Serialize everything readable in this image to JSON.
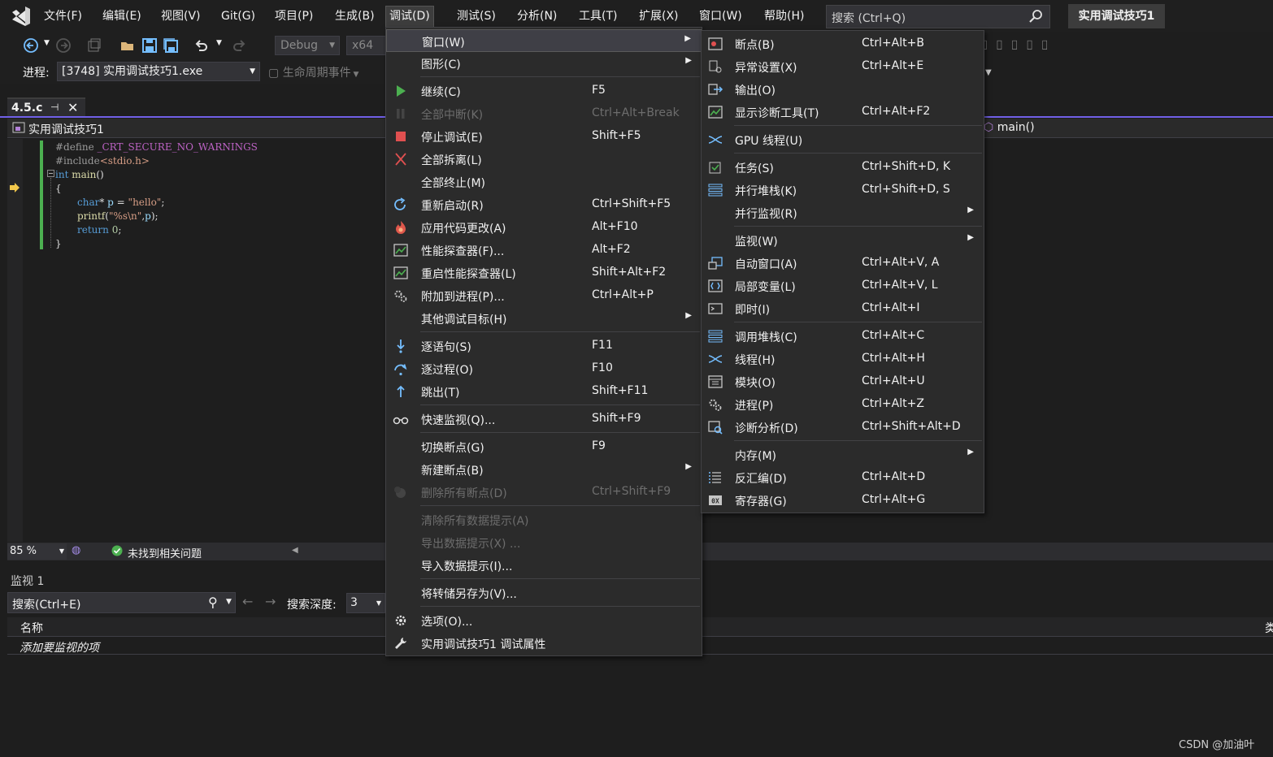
{
  "menubar": {
    "items": [
      "文件(F)",
      "编辑(E)",
      "视图(V)",
      "Git(G)",
      "项目(P)",
      "生成(B)",
      "调试(D)",
      "测试(S)",
      "分析(N)",
      "工具(T)",
      "扩展(X)",
      "窗口(W)",
      "帮助(H)"
    ],
    "active_index": 6,
    "search_placeholder": "搜索 (Ctrl+Q)",
    "solution_name": "实用调试技巧1"
  },
  "toolbar": {
    "config": "Debug",
    "platform": "x64",
    "process_label": "进程:",
    "process_value": "[3748] 实用调试技巧1.exe",
    "lifecycle_label": "生命周期事件"
  },
  "editor": {
    "tab_name": "4.5.c",
    "project_name": "实用调试技巧1",
    "function_name": "main()",
    "zoom": "85 %",
    "status": "未找到相关问题",
    "accent_color": "#7160e8",
    "change_bar_color": "#4cb050"
  },
  "watch": {
    "title": "监视 1",
    "search_placeholder": "搜索(Ctrl+E)",
    "depth_label": "搜索深度:",
    "depth_value": "3",
    "col_name": "名称",
    "col_type_partial": "类",
    "add_item": "添加要监视的项"
  },
  "debug_menu": [
    {
      "label": "窗口(W)",
      "shortcut": "",
      "submenu": true,
      "icon": "",
      "highlighted": true,
      "disabled": false
    },
    {
      "label": "图形(C)",
      "shortcut": "",
      "submenu": true,
      "icon": "",
      "disabled": false
    },
    {
      "sep": true
    },
    {
      "label": "继续(C)",
      "shortcut": "F5",
      "icon": "play-icon",
      "disabled": false
    },
    {
      "label": "全部中断(K)",
      "shortcut": "Ctrl+Alt+Break",
      "icon": "pause-icon",
      "disabled": true
    },
    {
      "label": "停止调试(E)",
      "shortcut": "Shift+F5",
      "icon": "stop-icon",
      "disabled": false
    },
    {
      "label": "全部拆离(L)",
      "shortcut": "",
      "icon": "detach-icon",
      "disabled": false
    },
    {
      "label": "全部终止(M)",
      "shortcut": "",
      "icon": "",
      "disabled": false
    },
    {
      "label": "重新启动(R)",
      "shortcut": "Ctrl+Shift+F5",
      "icon": "restart-icon",
      "disabled": false
    },
    {
      "label": "应用代码更改(A)",
      "shortcut": "Alt+F10",
      "icon": "hot-reload-icon",
      "disabled": false
    },
    {
      "label": "性能探查器(F)...",
      "shortcut": "Alt+F2",
      "icon": "profiler-icon",
      "disabled": false
    },
    {
      "label": "重启性能探查器(L)",
      "shortcut": "Shift+Alt+F2",
      "icon": "profiler-restart-icon",
      "disabled": false
    },
    {
      "label": "附加到进程(P)...",
      "shortcut": "Ctrl+Alt+P",
      "icon": "attach-icon",
      "disabled": false
    },
    {
      "label": "其他调试目标(H)",
      "shortcut": "",
      "submenu": true,
      "icon": "",
      "disabled": false
    },
    {
      "sep": true
    },
    {
      "label": "逐语句(S)",
      "shortcut": "F11",
      "icon": "step-into-icon",
      "disabled": false
    },
    {
      "label": "逐过程(O)",
      "shortcut": "F10",
      "icon": "step-over-icon",
      "disabled": false
    },
    {
      "label": "跳出(T)",
      "shortcut": "Shift+F11",
      "icon": "step-out-icon",
      "disabled": false
    },
    {
      "sep": true
    },
    {
      "label": "快速监视(Q)...",
      "shortcut": "Shift+F9",
      "icon": "quickwatch-icon",
      "disabled": false
    },
    {
      "sep": true
    },
    {
      "label": "切换断点(G)",
      "shortcut": "F9",
      "icon": "",
      "disabled": false
    },
    {
      "label": "新建断点(B)",
      "shortcut": "",
      "submenu": true,
      "icon": "",
      "disabled": false
    },
    {
      "label": "删除所有断点(D)",
      "shortcut": "Ctrl+Shift+F9",
      "icon": "delete-breakpoints-icon",
      "disabled": true
    },
    {
      "sep": true
    },
    {
      "label": "清除所有数据提示(A)",
      "shortcut": "",
      "icon": "",
      "disabled": true
    },
    {
      "label": "导出数据提示(X) ...",
      "shortcut": "",
      "icon": "",
      "disabled": true
    },
    {
      "label": "导入数据提示(I)...",
      "shortcut": "",
      "icon": "",
      "disabled": false
    },
    {
      "sep": true
    },
    {
      "label": "将转储另存为(V)...",
      "shortcut": "",
      "icon": "",
      "disabled": false
    },
    {
      "sep": true
    },
    {
      "label": "选项(O)...",
      "shortcut": "",
      "icon": "gear-icon",
      "disabled": false
    },
    {
      "label": "实用调试技巧1 调试属性",
      "shortcut": "",
      "icon": "wrench-icon",
      "disabled": false
    }
  ],
  "window_menu": [
    {
      "label": "断点(B)",
      "shortcut": "Ctrl+Alt+B",
      "icon": "breakpoints-icon"
    },
    {
      "label": "异常设置(X)",
      "shortcut": "Ctrl+Alt+E",
      "icon": "exception-icon"
    },
    {
      "label": "输出(O)",
      "shortcut": "",
      "icon": "output-icon"
    },
    {
      "label": "显示诊断工具(T)",
      "shortcut": "Ctrl+Alt+F2",
      "icon": "diagnostics-icon"
    },
    {
      "sep": true
    },
    {
      "label": "GPU 线程(U)",
      "shortcut": "",
      "icon": "gpu-threads-icon"
    },
    {
      "sep": true
    },
    {
      "label": "任务(S)",
      "shortcut": "Ctrl+Shift+D, K",
      "icon": "tasks-icon"
    },
    {
      "label": "并行堆栈(K)",
      "shortcut": "Ctrl+Shift+D, S",
      "icon": "parallel-stacks-icon"
    },
    {
      "label": "并行监视(R)",
      "shortcut": "",
      "submenu": true,
      "icon": ""
    },
    {
      "sep": true
    },
    {
      "label": "监视(W)",
      "shortcut": "",
      "submenu": true,
      "icon": ""
    },
    {
      "label": "自动窗口(A)",
      "shortcut": "Ctrl+Alt+V, A",
      "icon": "autos-icon"
    },
    {
      "label": "局部变量(L)",
      "shortcut": "Ctrl+Alt+V, L",
      "icon": "locals-icon"
    },
    {
      "label": "即时(I)",
      "shortcut": "Ctrl+Alt+I",
      "icon": "immediate-icon"
    },
    {
      "sep": true
    },
    {
      "label": "调用堆栈(C)",
      "shortcut": "Ctrl+Alt+C",
      "icon": "call-stack-icon"
    },
    {
      "label": "线程(H)",
      "shortcut": "Ctrl+Alt+H",
      "icon": "threads-icon"
    },
    {
      "label": "模块(O)",
      "shortcut": "Ctrl+Alt+U",
      "icon": "modules-icon"
    },
    {
      "label": "进程(P)",
      "shortcut": "Ctrl+Alt+Z",
      "icon": "processes-icon"
    },
    {
      "label": "诊断分析(D)",
      "shortcut": "Ctrl+Shift+Alt+D",
      "icon": "diagnostic-analysis-icon"
    },
    {
      "sep": true
    },
    {
      "label": "内存(M)",
      "shortcut": "",
      "submenu": true,
      "icon": ""
    },
    {
      "label": "反汇编(D)",
      "shortcut": "Ctrl+Alt+D",
      "icon": "disassembly-icon"
    },
    {
      "label": "寄存器(G)",
      "shortcut": "Ctrl+Alt+G",
      "icon": "registers-icon"
    }
  ],
  "watermark": "CSDN @加油叶"
}
